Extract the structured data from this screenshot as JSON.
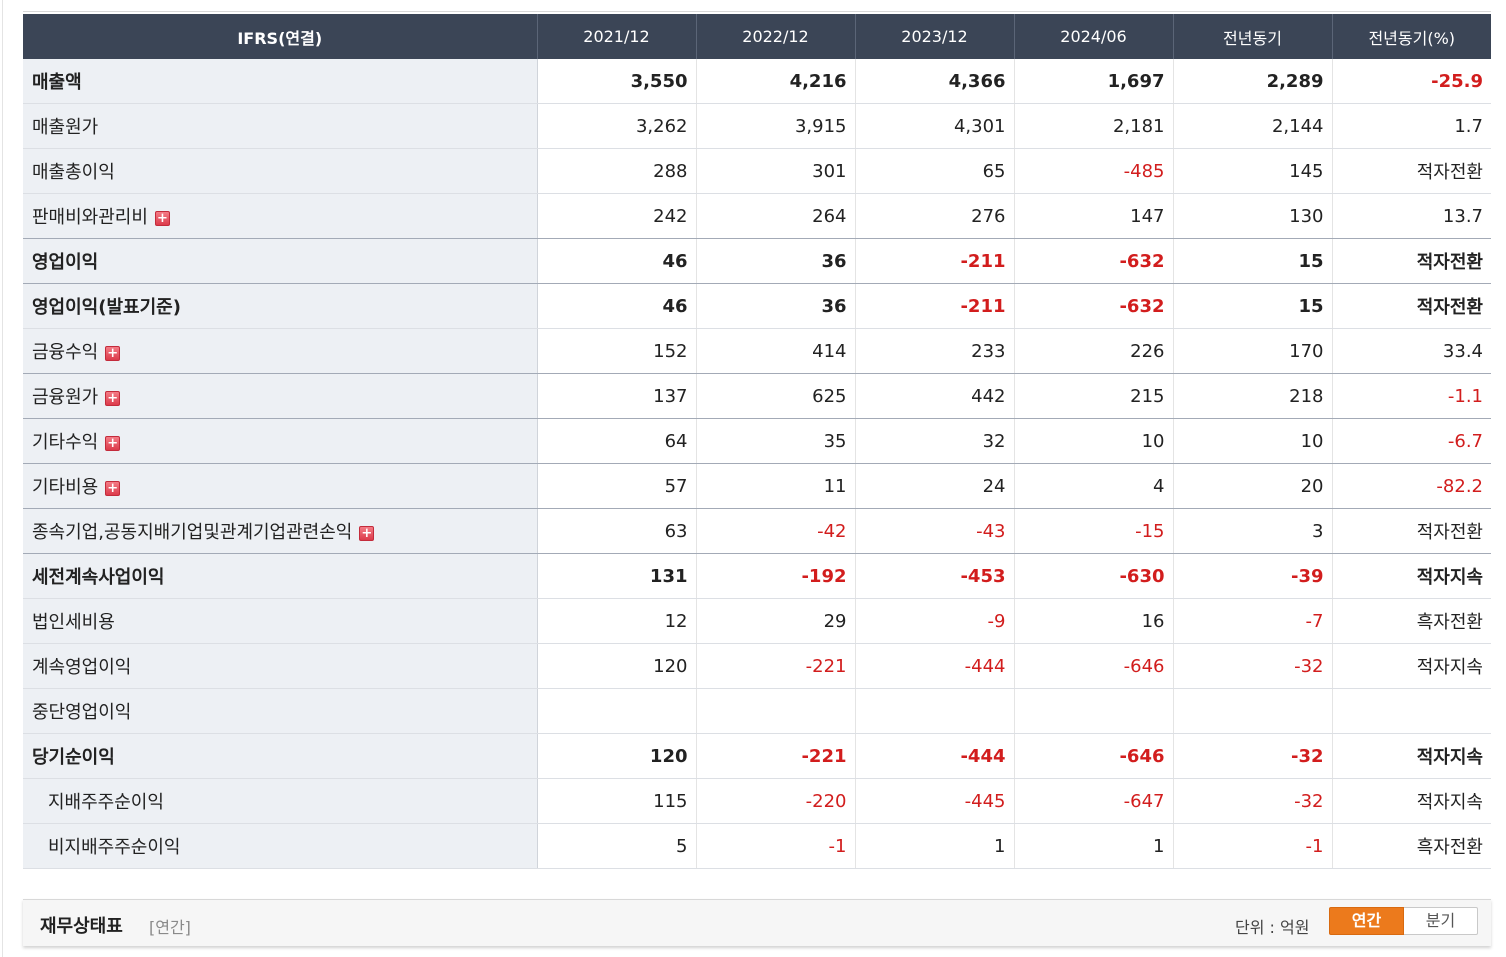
{
  "table": {
    "header": [
      "IFRS(연결)",
      "2021/12",
      "2022/12",
      "2023/12",
      "2024/06",
      "전년동기",
      "전년동기(%)"
    ],
    "rows": [
      {
        "label": "매출액",
        "bold": true,
        "plus": false,
        "sub": false,
        "values": [
          "3,550",
          "4,216",
          "4,366",
          "1,697",
          "2,289",
          "-25.9"
        ]
      },
      {
        "label": "매출원가",
        "bold": false,
        "plus": false,
        "sub": false,
        "values": [
          "3,262",
          "3,915",
          "4,301",
          "2,181",
          "2,144",
          "1.7"
        ]
      },
      {
        "label": "매출총이익",
        "bold": false,
        "plus": false,
        "sub": false,
        "values": [
          "288",
          "301",
          "65",
          "-485",
          "145",
          "적자전환"
        ]
      },
      {
        "label": "판매비와관리비",
        "bold": false,
        "plus": true,
        "sub": false,
        "values": [
          "242",
          "264",
          "276",
          "147",
          "130",
          "13.7"
        ]
      },
      {
        "label": "영업이익",
        "bold": true,
        "plus": false,
        "sub": false,
        "values": [
          "46",
          "36",
          "-211",
          "-632",
          "15",
          "적자전환"
        ]
      },
      {
        "label": "영업이익(발표기준)",
        "bold": true,
        "plus": false,
        "sub": false,
        "values": [
          "46",
          "36",
          "-211",
          "-632",
          "15",
          "적자전환"
        ]
      },
      {
        "label": "금융수익",
        "bold": false,
        "plus": true,
        "sub": false,
        "values": [
          "152",
          "414",
          "233",
          "226",
          "170",
          "33.4"
        ]
      },
      {
        "label": "금융원가",
        "bold": false,
        "plus": true,
        "sub": false,
        "values": [
          "137",
          "625",
          "442",
          "215",
          "218",
          "-1.1"
        ]
      },
      {
        "label": "기타수익",
        "bold": false,
        "plus": true,
        "sub": false,
        "values": [
          "64",
          "35",
          "32",
          "10",
          "10",
          "-6.7"
        ]
      },
      {
        "label": "기타비용",
        "bold": false,
        "plus": true,
        "sub": false,
        "values": [
          "57",
          "11",
          "24",
          "4",
          "20",
          "-82.2"
        ]
      },
      {
        "label": "종속기업,공동지배기업및관계기업관련손익",
        "bold": false,
        "plus": true,
        "sub": false,
        "values": [
          "63",
          "-42",
          "-43",
          "-15",
          "3",
          "적자전환"
        ]
      },
      {
        "label": "세전계속사업이익",
        "bold": true,
        "plus": false,
        "sub": false,
        "values": [
          "131",
          "-192",
          "-453",
          "-630",
          "-39",
          "적자지속"
        ]
      },
      {
        "label": "법인세비용",
        "bold": false,
        "plus": false,
        "sub": false,
        "values": [
          "12",
          "29",
          "-9",
          "16",
          "-7",
          "흑자전환"
        ]
      },
      {
        "label": "계속영업이익",
        "bold": false,
        "plus": false,
        "sub": false,
        "values": [
          "120",
          "-221",
          "-444",
          "-646",
          "-32",
          "적자지속"
        ]
      },
      {
        "label": "중단영업이익",
        "bold": false,
        "plus": false,
        "sub": false,
        "values": [
          "",
          "",
          "",
          "",
          "",
          ""
        ]
      },
      {
        "label": "당기순이익",
        "bold": true,
        "plus": false,
        "sub": false,
        "values": [
          "120",
          "-221",
          "-444",
          "-646",
          "-32",
          "적자지속"
        ]
      },
      {
        "label": "지배주주순이익",
        "bold": false,
        "plus": false,
        "sub": true,
        "values": [
          "115",
          "-220",
          "-445",
          "-647",
          "-32",
          "적자지속"
        ]
      },
      {
        "label": "비지배주주순이익",
        "bold": false,
        "plus": false,
        "sub": true,
        "values": [
          "5",
          "-1",
          "1",
          "1",
          "-1",
          "흑자전환"
        ]
      }
    ]
  },
  "panel": {
    "title": "재무상태표",
    "subtitle": "[연간]",
    "unit_label": "단위 : 억원",
    "annual_label": "연간",
    "quarter_label": "분기"
  },
  "colors": {
    "header_bg": "#3b4556",
    "negative": "#d21d1d",
    "accent": "#ec7a1c",
    "label_bg": "#edf0f4"
  },
  "icons": {
    "expand": "plus-icon"
  }
}
